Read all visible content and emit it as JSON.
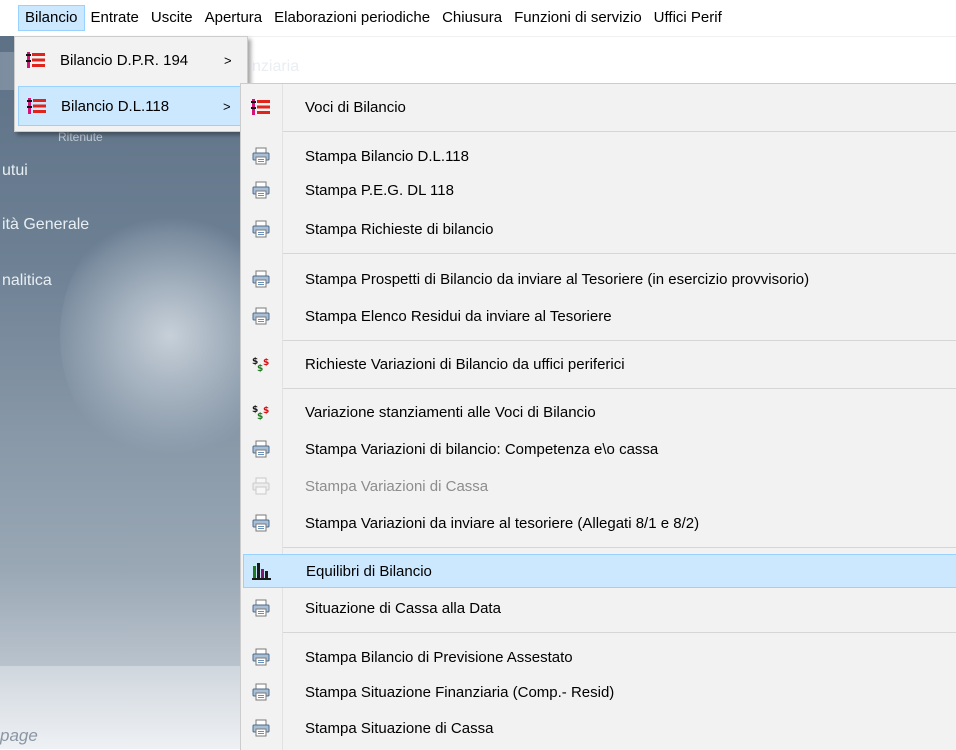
{
  "menubar": {
    "items": [
      {
        "label": "Bilancio",
        "active": true
      },
      {
        "label": "Entrate",
        "active": false
      },
      {
        "label": "Uscite",
        "active": false
      },
      {
        "label": "Apertura",
        "active": false
      },
      {
        "label": "Elaborazioni periodiche",
        "active": false
      },
      {
        "label": "Chiusura",
        "active": false
      },
      {
        "label": "Funzioni di servizio",
        "active": false
      },
      {
        "label": "Uffici Perif",
        "active": false
      }
    ]
  },
  "background": {
    "band_text": "nziaria",
    "small_text": "Ritenute",
    "items": [
      "utui",
      "ità Generale",
      "nalitica"
    ],
    "footer": "page"
  },
  "submenu1": {
    "items": [
      {
        "label": "Bilancio D.P.R. 194",
        "arrow": ">",
        "icon": "list-red-icon"
      },
      {
        "label": "Bilancio D.L.118",
        "arrow": ">",
        "icon": "list-red-icon"
      }
    ]
  },
  "submenu2": {
    "items": [
      {
        "label": "Voci di Bilancio",
        "icon": "list-red-icon"
      },
      {
        "label": "Stampa Bilancio D.L.118",
        "icon": "printer-icon"
      },
      {
        "label": "Stampa P.E.G.  DL 118",
        "icon": "printer-icon"
      },
      {
        "label": "Stampa Richieste di bilancio",
        "icon": "printer-icon"
      },
      {
        "label": "Stampa Prospetti di Bilancio da inviare al Tesoriere (in esercizio provvisorio)",
        "icon": "printer-icon"
      },
      {
        "label": "Stampa Elenco Residui da inviare al Tesoriere",
        "icon": "printer-icon"
      },
      {
        "label": "Richieste Variazioni di Bilancio da uffici periferici",
        "icon": "dollar-icon"
      },
      {
        "label": "Variazione stanziamenti alle Voci di Bilancio",
        "icon": "dollar-icon"
      },
      {
        "label": "Stampa Variazioni di bilancio: Competenza e\\o cassa",
        "icon": "printer-icon"
      },
      {
        "label": "Stampa Variazioni di Cassa",
        "icon": "printer-icon",
        "disabled": true
      },
      {
        "label": "Stampa Variazioni da inviare al tesoriere (Allegati 8/1 e 8/2)",
        "icon": "printer-icon"
      },
      {
        "label": "Equilibri di Bilancio",
        "icon": "bar-chart-icon",
        "highlighted": true
      },
      {
        "label": "Situazione di Cassa alla Data",
        "icon": "printer-icon"
      },
      {
        "label": "Stampa Bilancio di Previsione Assestato",
        "icon": "printer-icon"
      },
      {
        "label": "Stampa Situazione Finanziaria (Comp.- Resid)",
        "icon": "printer-icon"
      },
      {
        "label": "Stampa Situazione di Cassa",
        "icon": "printer-icon"
      }
    ]
  },
  "colors": {
    "highlight": "#cce8ff",
    "highlight_border": "#99d1ff",
    "menu_bg": "#f2f2f2"
  }
}
